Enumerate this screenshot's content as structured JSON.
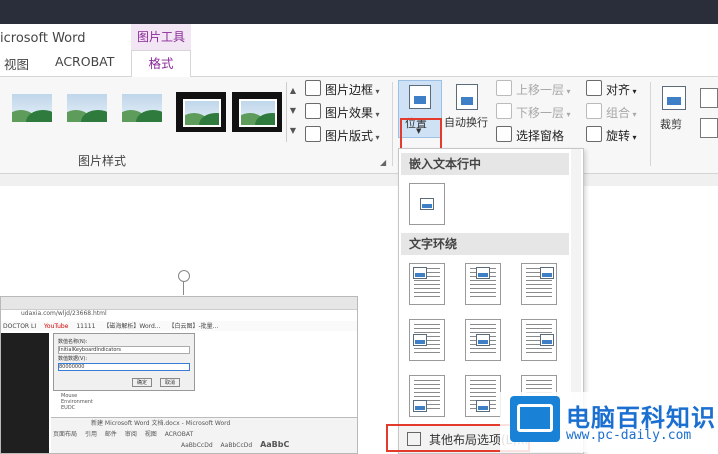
{
  "window": {
    "app_title": "icrosoft Word",
    "tools_ribbon": "图片工具"
  },
  "tabs": [
    {
      "label": "视图"
    },
    {
      "label": "ACROBAT"
    },
    {
      "label": "格式"
    }
  ],
  "picture_styles": {
    "group_label": "图片样式",
    "commands": [
      "图片边框",
      "图片效果",
      "图片版式"
    ]
  },
  "arrange": {
    "position_label": "位置",
    "wrap_text_label": "自动换行",
    "bring_forward": "上移一层",
    "send_backward": "下移一层",
    "selection_pane": "选择窗格",
    "align": "对齐",
    "group": "组合",
    "rotate": "旋转"
  },
  "size": {
    "crop_label": "裁剪"
  },
  "dropdown": {
    "inline_header": "嵌入文本行中",
    "wrap_header": "文字环绕",
    "more_options": "其他布局选项(L)..."
  },
  "embedded_screenshot": {
    "url": "udaxia.com/wljd/23668.html",
    "bookmarks": [
      "DOCTOR LI",
      "YouTube",
      "11111",
      "【磁海解析】Word...",
      "【白云图】-批量..."
    ],
    "dialog_rows": [
      "数值名称(N):",
      "InitialKeyboardIndicators",
      "数值数据(V):",
      "80000000"
    ],
    "dialog_buttons": [
      "确定",
      "取消"
    ],
    "word_title": "新建 Microsoft Word 文档.docx - Microsoft Word",
    "word_tabs": [
      "页面布局",
      "引用",
      "邮件",
      "审阅",
      "视图",
      "ACROBAT"
    ],
    "word_styles": [
      "AaBbCcDd",
      "AaBbCcDd",
      "AaBbC"
    ],
    "tree_items": [
      "Mouse",
      "Environment",
      "EUDC"
    ]
  },
  "watermark": {
    "text": "电脑百科知识",
    "url": "www.pc-daily.com"
  },
  "colors": {
    "accent_purple": "#8a2a9a",
    "highlight_red": "#e23b2e",
    "watermark_blue": "#1a6fd0"
  }
}
